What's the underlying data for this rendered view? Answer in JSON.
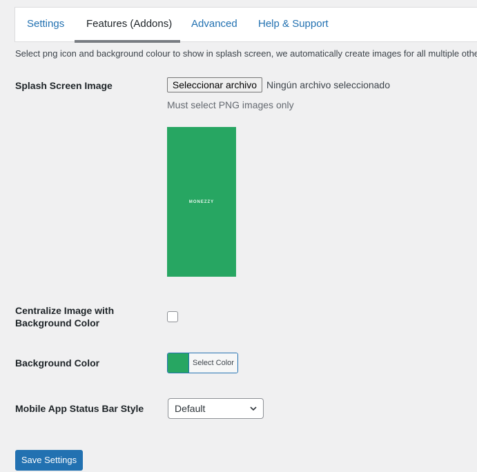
{
  "tabs": [
    {
      "label": "Settings",
      "active": false
    },
    {
      "label": "Features (Addons)",
      "active": true
    },
    {
      "label": "Advanced",
      "active": false
    },
    {
      "label": "Help & Support",
      "active": false
    }
  ],
  "intro": "Select png icon and background colour to show in splash screen, we automatically create images for all multiple other",
  "splash": {
    "label": "Splash Screen Image",
    "file_button": "Seleccionar archivo",
    "file_status": "Ningún archivo seleccionado",
    "hint": "Must select PNG images only",
    "preview_text": "MONEZZY",
    "preview_color": "#27a662"
  },
  "centralize": {
    "label_line1": "Centralize Image with",
    "label_line2": "Background Color",
    "checked": false
  },
  "background": {
    "label": "Background Color",
    "color": "#27a662",
    "button_label": "Select Color"
  },
  "status_bar": {
    "label": "Mobile App Status Bar Style",
    "selected": "Default"
  },
  "save_label": "Save Settings",
  "colors": {
    "accent": "#2271b1",
    "page_bg": "#f0f0f1"
  }
}
